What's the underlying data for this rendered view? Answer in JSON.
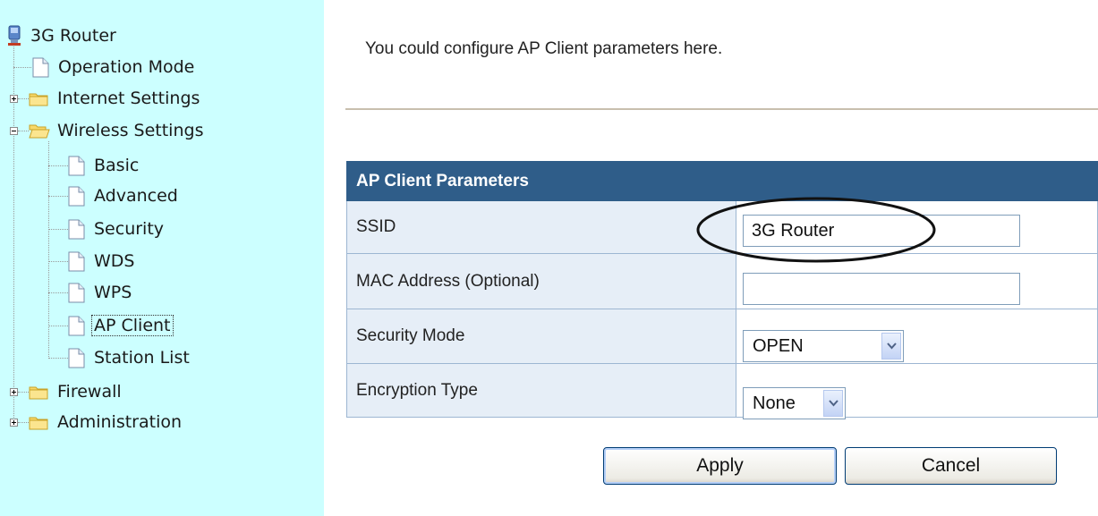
{
  "sidebar": {
    "root": {
      "label": "3G Router"
    },
    "items": [
      {
        "label": "Operation Mode"
      },
      {
        "label": "Internet Settings"
      },
      {
        "label": "Wireless Settings",
        "children": [
          {
            "label": "Basic"
          },
          {
            "label": "Advanced"
          },
          {
            "label": "Security"
          },
          {
            "label": "WDS"
          },
          {
            "label": "WPS"
          },
          {
            "label": "AP Client"
          },
          {
            "label": "Station List"
          }
        ]
      },
      {
        "label": "Firewall"
      },
      {
        "label": "Administration"
      }
    ]
  },
  "main": {
    "intro": "You could configure AP Client parameters here.",
    "table": {
      "header": "AP Client Parameters",
      "ssid": {
        "label": "SSID",
        "value": "3G Router"
      },
      "mac": {
        "label": "MAC Address (Optional)",
        "value": ""
      },
      "security_mode": {
        "label": "Security Mode",
        "selected": "OPEN"
      },
      "encryption_type": {
        "label": "Encryption Type",
        "selected": "None"
      }
    },
    "buttons": {
      "apply": "Apply",
      "cancel": "Cancel"
    }
  },
  "colors": {
    "sidebar_bg": "#ccffff",
    "table_header_bg": "#2f5d89",
    "label_cell_bg": "#e6eef7"
  }
}
